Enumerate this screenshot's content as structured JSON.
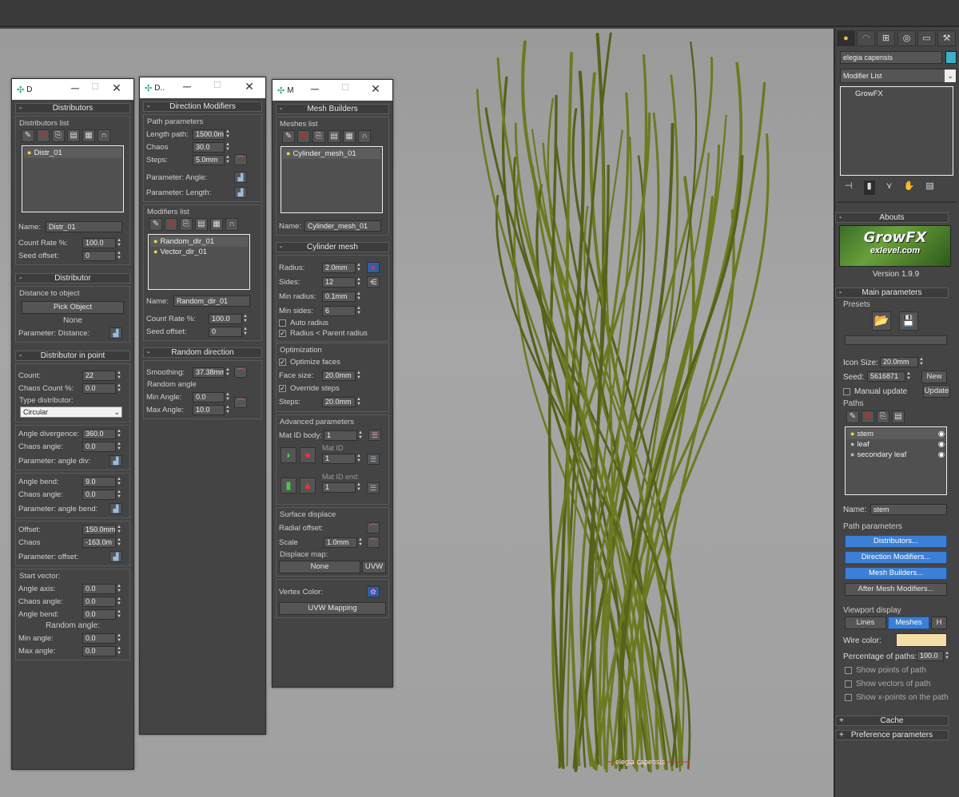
{
  "viewport": {
    "label": "elegia capensis"
  },
  "distributors_window": {
    "title": "D",
    "rollout_distributors": {
      "header": "Distributors",
      "list_label": "Distributors list",
      "items": [
        "Distr_01"
      ],
      "name_label": "Name:",
      "name_value": "Distr_01",
      "count_rate_label": "Count Rate %:",
      "count_rate": "100.0",
      "seed_offset_label": "Seed offset:",
      "seed_offset": "0"
    },
    "rollout_distributor": {
      "header": "Distributor",
      "distance_label": "Distance to object",
      "pick_button": "Pick Object",
      "pick_value": "None",
      "param_distance": "Parameter: Distance:"
    },
    "rollout_in_point": {
      "header": "Distributor in point",
      "count_label": "Count:",
      "count": "22",
      "chaos_count_label": "Chaos Count %:",
      "chaos_count": "0.0",
      "type_label": "Type distributor:",
      "type_value": "Circular",
      "angle_div_label": "Angle divergence:",
      "angle_div": "360.0",
      "chaos_angle_label": "Chaos angle:",
      "chaos_angle_1": "0.0",
      "param_angle_div": "Parameter: angle div:",
      "angle_bend_label": "Angle bend:",
      "angle_bend": "9.0",
      "chaos_angle_2": "0.0",
      "param_angle_bend": "Parameter: angle bend:",
      "offset_label": "Offset:",
      "offset": "150.0mm",
      "chaos_label": "Chaos",
      "chaos": "-163.0m",
      "param_offset": "Parameter: offset:",
      "start_vector_label": "Start vector:",
      "angle_axis_label": "Angle axis:",
      "angle_axis": "0.0",
      "sv_chaos_angle": "0.0",
      "sv_angle_bend_label": "Angle bend:",
      "sv_angle_bend": "0.0",
      "random_angle_label": "Random angle:",
      "min_angle_label": "Min angle:",
      "min_angle": "0.0",
      "max_angle_label": "Max angle:",
      "max_angle": "0.0"
    }
  },
  "direction_window": {
    "title": "D..",
    "rollout_dir": {
      "header": "Direction Modifiers",
      "path_params": "Path parameters",
      "length_label": "Length path:",
      "length": "1500.0m",
      "chaos_label": "Chaos",
      "chaos": "30.0",
      "steps_label": "Steps:",
      "steps": "5.0mm",
      "param_angle": "Parameter: Angle:",
      "param_length": "Parameter: Length:",
      "modifiers_list": "Modifiers list",
      "items": [
        "Random_dir_01",
        "Vector_dir_01"
      ],
      "name_label": "Name:",
      "name_value": "Random_dir_01",
      "count_rate_label": "Count Rate %:",
      "count_rate": "100.0",
      "seed_offset_label": "Seed offset:",
      "seed_offset": "0"
    },
    "rollout_random": {
      "header": "Random direction",
      "smoothing_label": "Smoothing:",
      "smoothing": "37.38mm",
      "random_angle": "Random angle",
      "min_label": "Min Angle:",
      "min": "0.0",
      "max_label": "Max Angle:",
      "max": "10.0"
    }
  },
  "mesh_window": {
    "title": "M",
    "rollout_builders": {
      "header": "Mesh Builders",
      "list_label": "Meshes list",
      "items": [
        "Cylinder_mesh_01"
      ],
      "name_label": "Name:",
      "name_value": "Cylinder_mesh_01"
    },
    "rollout_cylinder": {
      "header": "Cylinder mesh",
      "radius_label": "Radius:",
      "radius": "2.0mm",
      "sides_label": "Sides:",
      "sides": "12",
      "min_radius_label": "Min radius:",
      "min_radius": "0.1mm",
      "min_sides_label": "Min sides:",
      "min_sides": "6",
      "auto_radius": "Auto radius",
      "radius_parent": "Radius < Parent radius",
      "optimization": "Optimization",
      "optimize_faces": "Optimize faces",
      "face_size_label": "Face size:",
      "face_size": "20.0mm",
      "override_steps": "Override steps",
      "steps_label": "Steps:",
      "steps": "20.0mm",
      "advanced": "Advanced parameters",
      "mat_id_body_label": "Mat ID body:",
      "mat_id_body": "1",
      "mat_id_label": "Mat ID",
      "mat_id": "1",
      "mat_id_end_label": "Mat ID end:",
      "mat_id_end": "1",
      "surface_displace": "Surface displace",
      "radial_offset": "Radial offset:",
      "scale_label": "Scale",
      "scale": "1.0mm",
      "displace_map": "Displace map:",
      "none_button": "None",
      "uvw_button": "UVW",
      "vertex_color": "Vertex Color:",
      "uvw_mapping": "UVW Mapping"
    }
  },
  "command_panel": {
    "object_name": "elegia capensis",
    "modifier_list": "Modifier List",
    "stack_items": [
      "GrowFX"
    ],
    "abouts_header": "Abouts",
    "logo_text": "GrowFX",
    "logo_sub": "exlevel.com",
    "version": "Version 1.9.9",
    "main_params_header": "Main parameters",
    "presets_label": "Presets",
    "icon_size_label": "Icon Size:",
    "icon_size": "20.0mm",
    "seed_label": "Seed:",
    "seed": "5616871",
    "new_button": "New",
    "manual_update": "Manual update",
    "update_button": "Update",
    "paths_label": "Paths",
    "paths": [
      "stem",
      "leaf",
      "secondary leaf"
    ],
    "name_label": "Name:",
    "name_value": "stem",
    "path_params_label": "Path parameters",
    "distributors_btn": "Distributors...",
    "direction_btn": "Direction Modifiers...",
    "mesh_btn": "Mesh Builders...",
    "after_mesh_btn": "After Mesh Modifiers...",
    "viewport_display": "Viewport display",
    "lines_btn": "Lines",
    "meshes_btn": "Meshes",
    "h_btn": "H",
    "wire_color_label": "Wire color:",
    "wire_color": "#f5dea6",
    "percent_label": "Percentage of paths:",
    "percent": "100.0",
    "show_points": "Show points of path",
    "show_vectors": "Show vectors of path",
    "show_xpoints": "Show x-points on the path",
    "cache_header": "Cache",
    "pref_header": "Preference parameters"
  },
  "colors": {
    "accent_blue": "#3c7fd6",
    "grass": "#6b7a20",
    "object_color": "#3bb0c9"
  }
}
